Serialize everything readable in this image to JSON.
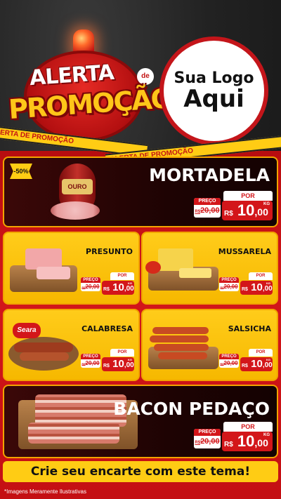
{
  "header": {
    "alert_line1": "ALERTA",
    "alert_de": "de",
    "alert_line2": "PROMOÇÃO",
    "logo_line1": "Sua Logo",
    "logo_line2": "Aqui",
    "tape_text": "ALERTA DE PROMOÇÃO"
  },
  "products": {
    "mortadela": {
      "name": "MORTADELA",
      "brand_label": "OURO",
      "discount": "-50%",
      "por": "POR",
      "preco_label": "PREÇO",
      "old_cur": "R$",
      "old_price": "20,00",
      "cur": "R$",
      "price_int": "10",
      "price_dec": ",00",
      "unit": "KG"
    },
    "presunto": {
      "name": "PRESUNTO",
      "por": "POR",
      "preco_label": "PREÇO",
      "old_cur": "R$",
      "old_price": "20,00",
      "cur": "R$",
      "price_int": "10",
      "price_dec": ",00",
      "unit": "KG"
    },
    "mussarela": {
      "name": "MUSSARELA",
      "por": "POR",
      "preco_label": "PREÇO",
      "old_cur": "R$",
      "old_price": "20,00",
      "cur": "R$",
      "price_int": "10",
      "price_dec": ",00",
      "unit": "KG"
    },
    "calabresa": {
      "name": "CALABRESA",
      "brand_label": "Seara",
      "por": "POR",
      "preco_label": "PREÇO",
      "old_cur": "R$",
      "old_price": "20,00",
      "cur": "R$",
      "price_int": "10",
      "price_dec": ",00",
      "unit": "KG"
    },
    "salsicha": {
      "name": "SALSICHA",
      "por": "POR",
      "preco_label": "PREÇO",
      "old_cur": "R$",
      "old_price": "20,00",
      "cur": "R$",
      "price_int": "10",
      "price_dec": ",00",
      "unit": "KG"
    },
    "bacon": {
      "name": "BACON PEDAÇO",
      "por": "POR",
      "preco_label": "PREÇO",
      "old_cur": "R$",
      "old_price": "20,00",
      "cur": "R$",
      "price_int": "10",
      "price_dec": ",00",
      "unit": "KG"
    }
  },
  "cta": "Crie seu encarte com este tema!",
  "footnote": "*Imagens Meramente Ilustrativas",
  "colors": {
    "red": "#d3161a",
    "yellow": "#ffcc14",
    "dark": "#1e0303"
  }
}
